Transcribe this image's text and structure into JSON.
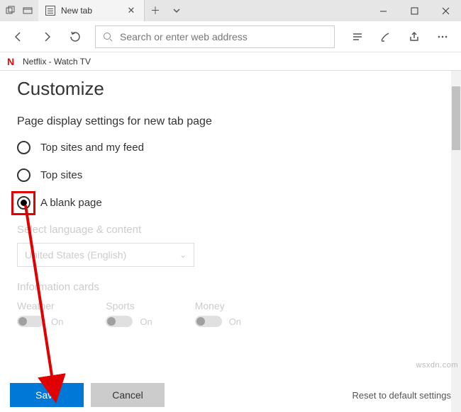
{
  "titlebar": {
    "tab_label": "New tab"
  },
  "toolbar": {
    "search_placeholder": "Search or enter web address"
  },
  "sitebar": {
    "logo_text": "N",
    "site_title": "Netflix - Watch TV"
  },
  "page": {
    "heading": "Customize",
    "subtitle": "Page display settings for new tab page",
    "options": [
      {
        "label": "Top sites and my feed"
      },
      {
        "label": "Top sites"
      },
      {
        "label": "A blank page"
      }
    ],
    "lang_section": "Select language & content",
    "lang_value": "United States (English)",
    "cards_section": "Information cards",
    "cards": [
      {
        "name": "Weather",
        "state": "On"
      },
      {
        "name": "Sports",
        "state": "On"
      },
      {
        "name": "Money",
        "state": "On"
      }
    ]
  },
  "footer": {
    "save": "Save",
    "cancel": "Cancel",
    "reset": "Reset to default settings"
  },
  "watermark": "wsxdn.com"
}
